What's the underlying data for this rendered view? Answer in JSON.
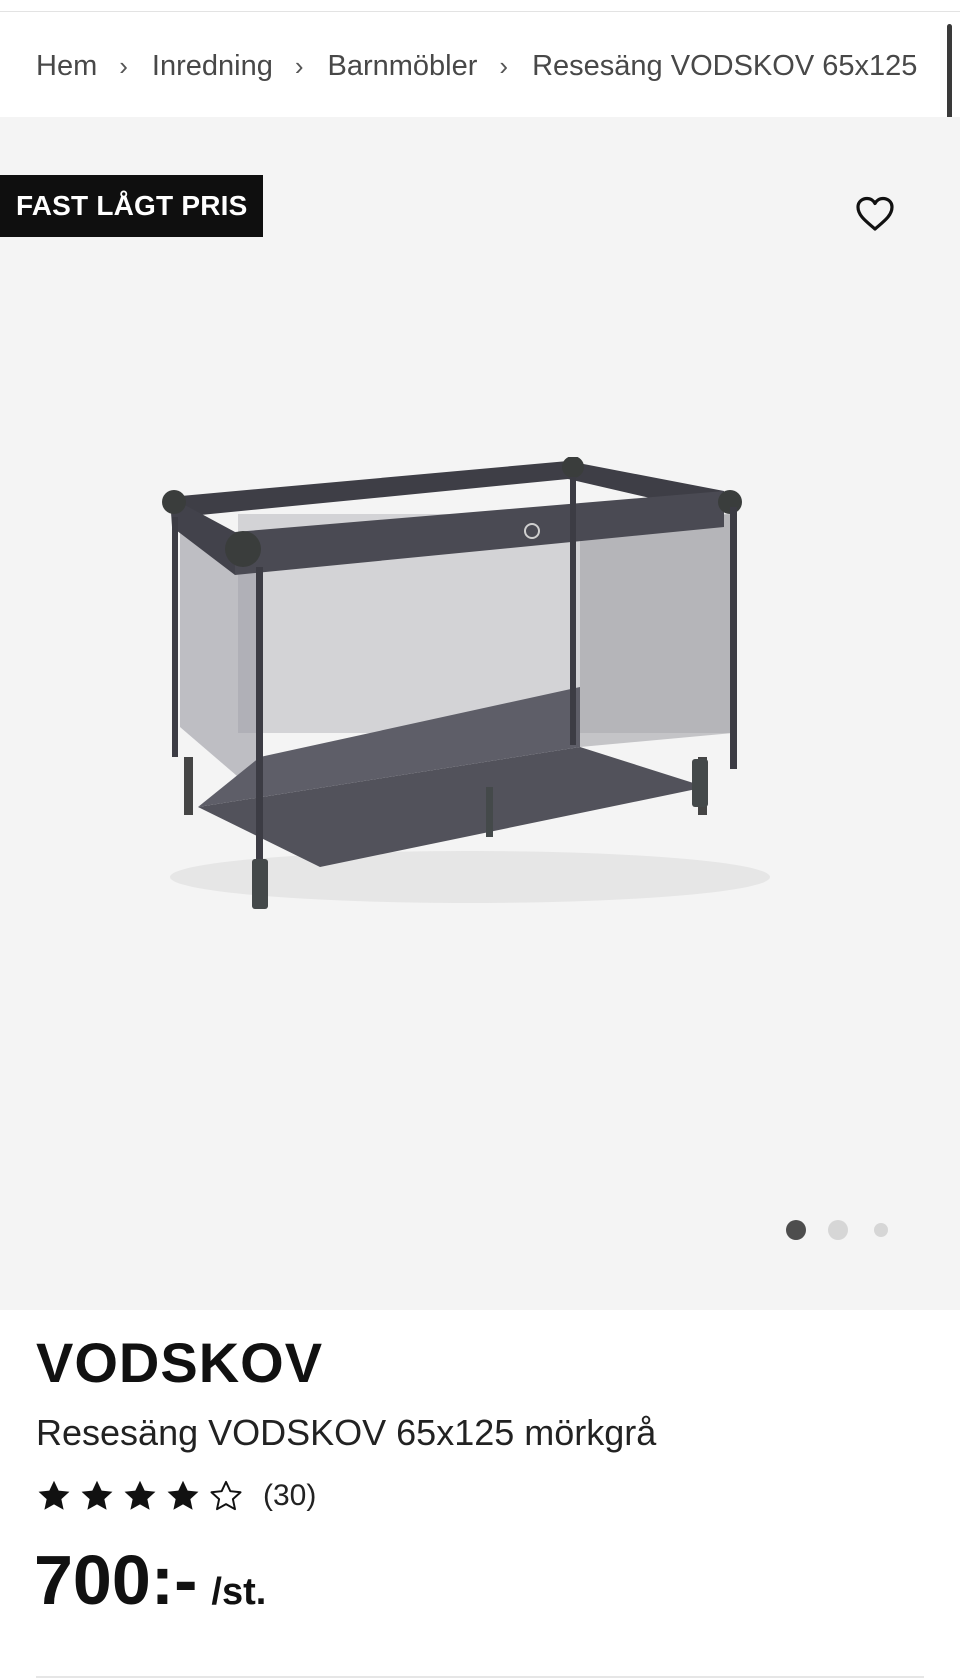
{
  "breadcrumb": {
    "items": [
      {
        "label": "Hem"
      },
      {
        "label": "Inredning"
      },
      {
        "label": "Barnmöbler"
      },
      {
        "label": "Resesäng VODSKOV 65x125"
      }
    ],
    "separator": "›"
  },
  "gallery": {
    "badge": "FAST LÅGT PRIS",
    "favorite_icon": "heart-outline-icon",
    "image_count": 3,
    "active_index": 0
  },
  "product": {
    "brand": "VODSKOV",
    "title": "Resesäng VODSKOV 65x125 mörkgrå",
    "rating": 4,
    "rating_max": 5,
    "review_count": "(30)",
    "price": "700:-",
    "price_unit": "/st."
  },
  "colors": {
    "badge_bg": "#0f0f0f",
    "hero_bg": "#f4f4f4",
    "star_fill": "#111111"
  }
}
